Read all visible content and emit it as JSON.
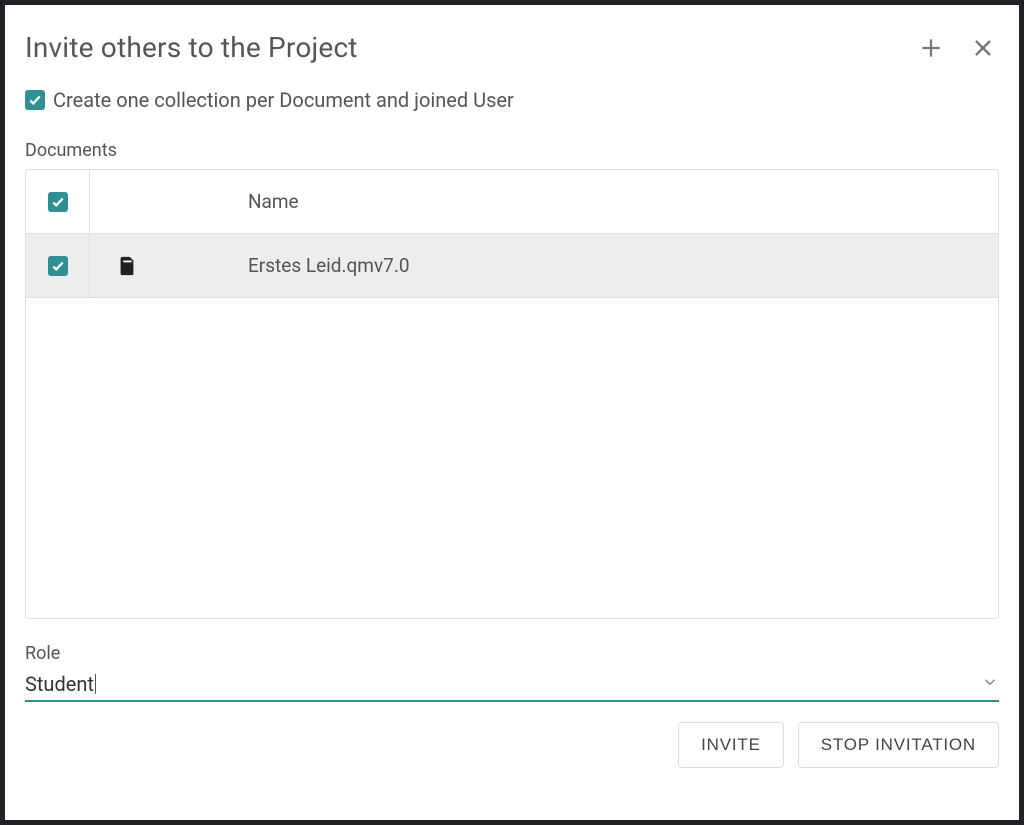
{
  "dialog": {
    "title": "Invite others to the Project",
    "create_collection_label": "Create one collection per Document and joined User",
    "create_collection_checked": true
  },
  "documents": {
    "section_label": "Documents",
    "columns": {
      "name": "Name"
    },
    "select_all_checked": true,
    "rows": [
      {
        "checked": true,
        "name": "Erstes Leid.qmv7.0"
      }
    ]
  },
  "role": {
    "label": "Role",
    "value": "Student"
  },
  "actions": {
    "invite": "INVITE",
    "stop": "STOP INVITATION"
  }
}
